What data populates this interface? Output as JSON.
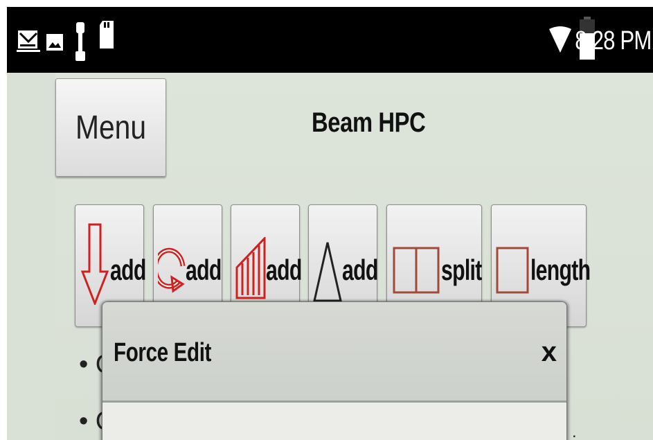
{
  "status_bar": {
    "time": "8:28 PM",
    "notification_icons": [
      "gmail-icon",
      "gallery-icon",
      "usb-debug-icon",
      "sd-card-icon"
    ],
    "system_icons": [
      "wifi-icon",
      "battery-icon"
    ]
  },
  "header": {
    "menu_label": "Menu",
    "title": "Beam HPC"
  },
  "toolbar": {
    "buttons": [
      {
        "label": "add",
        "icon": "down-arrow-force-icon"
      },
      {
        "label": "add",
        "icon": "moment-circular-arrow-icon"
      },
      {
        "label": "add",
        "icon": "distributed-load-icon"
      },
      {
        "label": "add",
        "icon": "triangle-support-icon"
      },
      {
        "label": "split",
        "icon": "split-beam-icon"
      },
      {
        "label": "length",
        "icon": "beam-length-icon"
      }
    ]
  },
  "list": {
    "items": [
      "• O",
      "• O"
    ]
  },
  "dialog": {
    "title": "Force Edit",
    "close_label": "x"
  },
  "colors": {
    "status_bar_bg": "#000000",
    "app_bg": "#dde4da",
    "icon_red": "#d02020",
    "icon_brown": "#a04a3a"
  }
}
